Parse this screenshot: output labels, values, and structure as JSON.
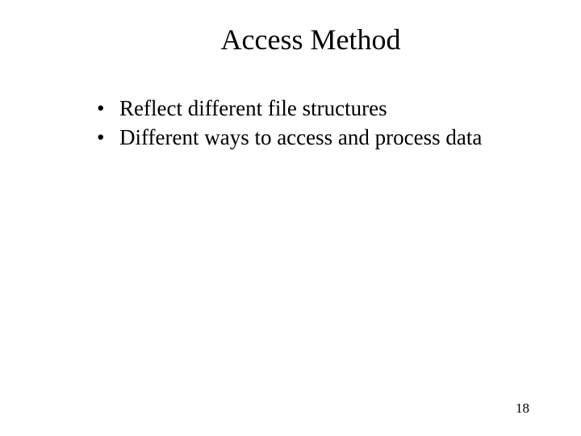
{
  "slide": {
    "title": "Access Method",
    "bullets": [
      "Reflect different file structures",
      "Different ways to access and process data"
    ],
    "page_number": "18"
  }
}
